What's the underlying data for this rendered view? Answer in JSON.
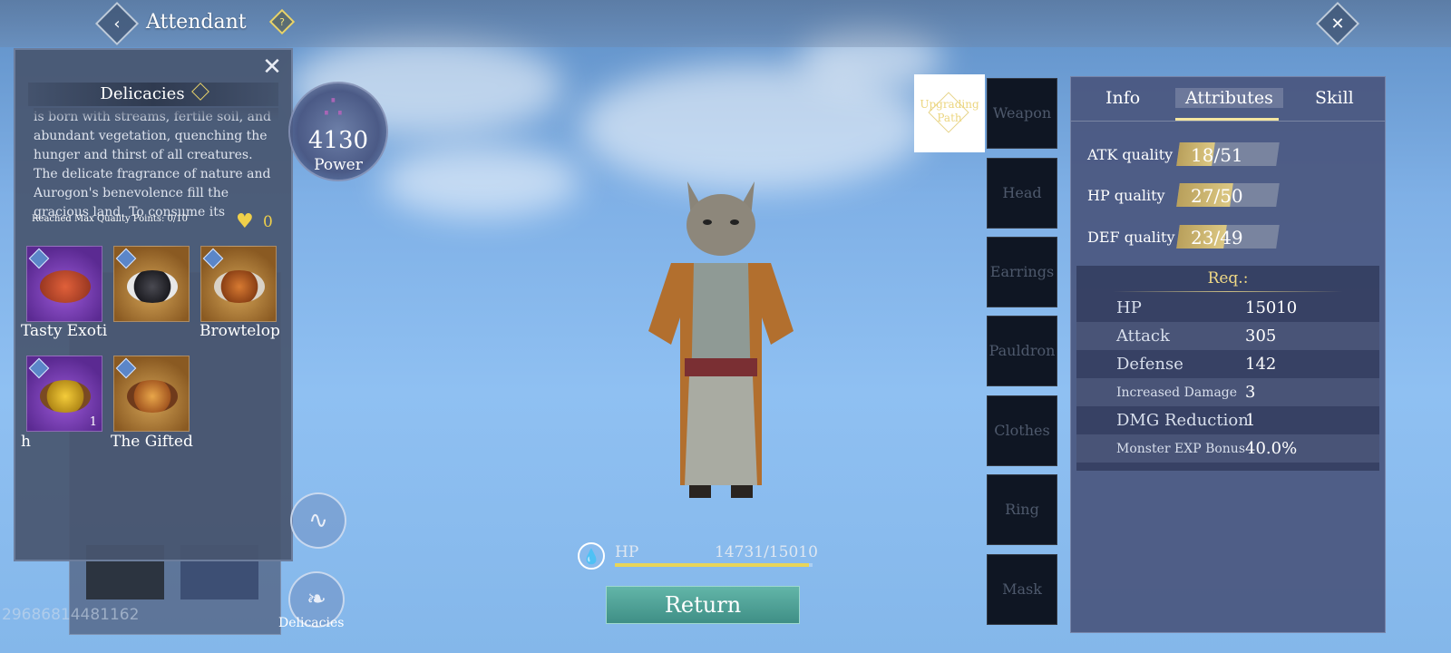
{
  "header": {
    "title": "Attendant"
  },
  "popup": {
    "title": "Delicacies",
    "description": "is born with streams, fertile soil, and abundant vegetation, quenching the hunger and thirst of all creatures. The delicate fragrance of nature and Aurogon's benevolence fill the gracious land. To consume its",
    "max_quality": "Reached Max Quality Points: 0/10",
    "heart_count": "0",
    "items": [
      {
        "name": "Tasty Exoti",
        "rarity": "purple",
        "count": ""
      },
      {
        "name": "",
        "rarity": "gold",
        "count": ""
      },
      {
        "name": "Browtelop",
        "rarity": "gold",
        "count": ""
      },
      {
        "name": "h",
        "rarity": "purple",
        "count": "1"
      },
      {
        "name": "The Gifted",
        "rarity": "gold",
        "count": ""
      }
    ]
  },
  "power": {
    "value": "4130",
    "label": "Power"
  },
  "background_id": "29686814481162",
  "delicacies_button": {
    "label": "Delicacies"
  },
  "hp": {
    "label": "HP",
    "value": "14731/15010",
    "fraction": 0.981
  },
  "return_button": {
    "label": "Return"
  },
  "equipment": {
    "upgrade_path": "Upgrading Path",
    "slots": [
      "Weapon",
      "Head",
      "Earrings",
      "Pauldron",
      "Clothes",
      "Ring",
      "Mask"
    ]
  },
  "panel": {
    "tabs": [
      "Info",
      "Attributes",
      "Skill"
    ],
    "active_tab": "Attributes",
    "qualities": [
      {
        "label": "ATK quality",
        "current": 18,
        "max": 51,
        "text": "18/51"
      },
      {
        "label": "HP quality",
        "current": 27,
        "max": 50,
        "text": "27/50"
      },
      {
        "label": "DEF quality",
        "current": 23,
        "max": 49,
        "text": "23/49"
      }
    ],
    "req_title": "Req.:",
    "stats": [
      {
        "key": "HP",
        "value": "15010"
      },
      {
        "key": "Attack",
        "value": "305"
      },
      {
        "key": "Defense",
        "value": "142"
      },
      {
        "key": "Increased Damage",
        "value": "3"
      },
      {
        "key": "DMG Reduction",
        "value": "1"
      },
      {
        "key": "Monster EXP Bonus",
        "value": "40.0%"
      }
    ]
  },
  "colors": {
    "accent_gold": "#e9d558",
    "return_teal": "#4fa398",
    "panel": "#4a567e"
  }
}
